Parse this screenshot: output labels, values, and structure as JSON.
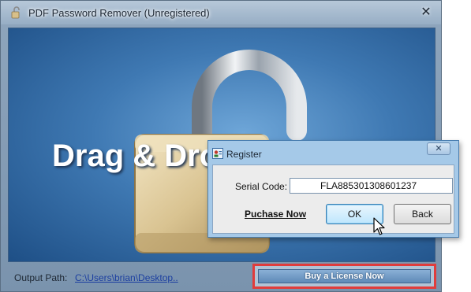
{
  "window": {
    "title": "PDF Password Remover (Unregistered)",
    "close_glyph": "✕",
    "icon": "lock-icon"
  },
  "drop_area": {
    "text": "Drag & Dro",
    "icon": "open-padlock-icon"
  },
  "footer": {
    "output_label": "Output Path:",
    "output_path": "C:\\Users\\brian\\Desktop..",
    "buy_label": "Buy a License Now",
    "highlight_color": "#e03c3c"
  },
  "dialog": {
    "title": "Register",
    "close_glyph": "✕",
    "serial_label": "Serial Code:",
    "serial_value": "FLA885301308601237",
    "purchase_link": "Puchase Now",
    "ok_label": "OK",
    "back_label": "Back"
  }
}
